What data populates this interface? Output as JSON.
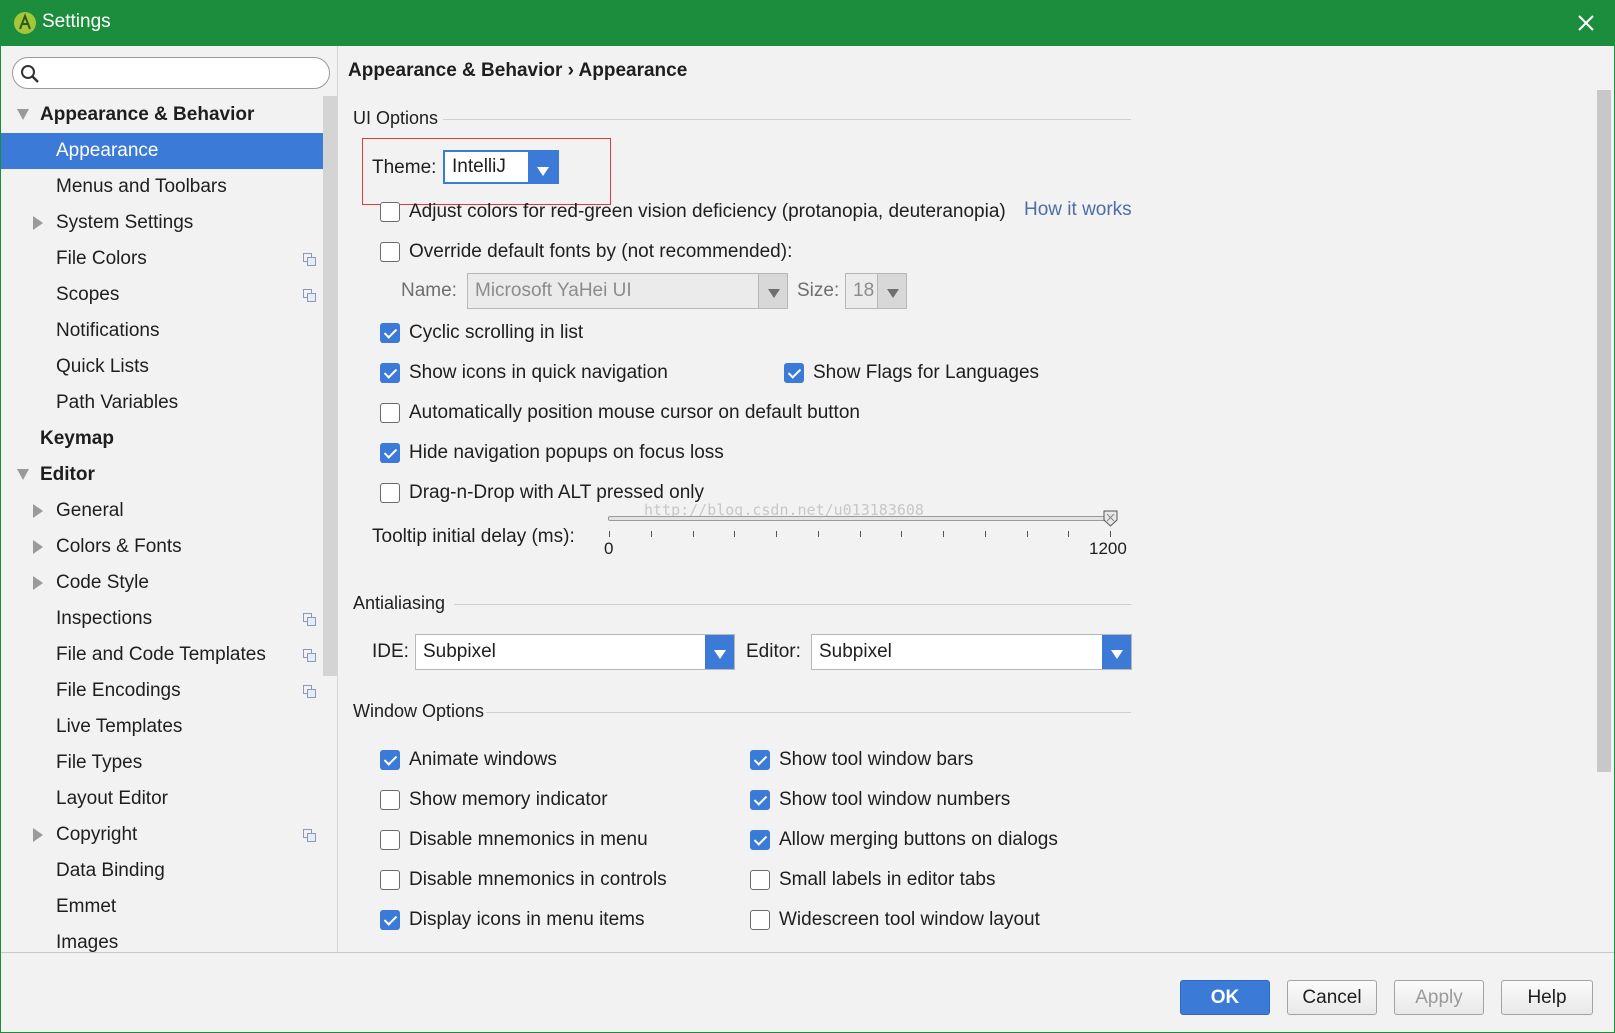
{
  "window": {
    "title": "Settings"
  },
  "search": {
    "placeholder": "",
    "value": ""
  },
  "tree": [
    {
      "label": "Appearance & Behavior",
      "level": 0,
      "arrow": "down",
      "bold": true
    },
    {
      "label": "Appearance",
      "level": 1,
      "selected": true
    },
    {
      "label": "Menus and Toolbars",
      "level": 1
    },
    {
      "label": "System Settings",
      "level": 1,
      "arrow": "right"
    },
    {
      "label": "File Colors",
      "level": 1,
      "project_icon": true
    },
    {
      "label": "Scopes",
      "level": 1,
      "project_icon": true
    },
    {
      "label": "Notifications",
      "level": 1
    },
    {
      "label": "Quick Lists",
      "level": 1
    },
    {
      "label": "Path Variables",
      "level": 1
    },
    {
      "label": "Keymap",
      "level": 0,
      "bold": true
    },
    {
      "label": "Editor",
      "level": 0,
      "arrow": "down",
      "bold": true
    },
    {
      "label": "General",
      "level": 1,
      "arrow": "right"
    },
    {
      "label": "Colors & Fonts",
      "level": 1,
      "arrow": "right"
    },
    {
      "label": "Code Style",
      "level": 1,
      "arrow": "right"
    },
    {
      "label": "Inspections",
      "level": 1,
      "project_icon": true
    },
    {
      "label": "File and Code Templates",
      "level": 1,
      "project_icon": true
    },
    {
      "label": "File Encodings",
      "level": 1,
      "project_icon": true
    },
    {
      "label": "Live Templates",
      "level": 1
    },
    {
      "label": "File Types",
      "level": 1
    },
    {
      "label": "Layout Editor",
      "level": 1
    },
    {
      "label": "Copyright",
      "level": 1,
      "arrow": "right",
      "project_icon": true
    },
    {
      "label": "Data Binding",
      "level": 1
    },
    {
      "label": "Emmet",
      "level": 1
    },
    {
      "label": "Images",
      "level": 1
    }
  ],
  "breadcrumb": "Appearance & Behavior › Appearance",
  "ui_options": {
    "title": "UI Options",
    "theme_label": "Theme:",
    "theme_value": "IntelliJ",
    "adjust_colors": {
      "label": "Adjust colors for red-green vision deficiency (protanopia, deuteranopia)",
      "checked": false
    },
    "how_it_works": "How it works",
    "override_fonts": {
      "label": "Override default fonts by (not recommended):",
      "checked": false
    },
    "font_name_label": "Name:",
    "font_name_value": "Microsoft YaHei UI",
    "font_size_label": "Size:",
    "font_size_value": "18",
    "cyclic_scrolling": {
      "label": "Cyclic scrolling in list",
      "checked": true
    },
    "show_icons_quick_nav": {
      "label": "Show icons in quick navigation",
      "checked": true
    },
    "show_flags": {
      "label": "Show Flags for Languages",
      "checked": true
    },
    "auto_mouse": {
      "label": "Automatically position mouse cursor on default button",
      "checked": false
    },
    "hide_nav_popups": {
      "label": "Hide navigation popups on focus loss",
      "checked": true
    },
    "drag_n_drop": {
      "label": "Drag-n-Drop with ALT pressed only",
      "checked": false
    },
    "tooltip_label": "Tooltip initial delay (ms):",
    "tooltip_min": "0",
    "tooltip_max": "1200",
    "tooltip_value_fraction": 1.0
  },
  "watermark": "http://blog.csdn.net/u013183608",
  "antialiasing": {
    "title": "Antialiasing",
    "ide_label": "IDE:",
    "ide_value": "Subpixel",
    "editor_label": "Editor:",
    "editor_value": "Subpixel"
  },
  "window_options": {
    "title": "Window Options",
    "animate_windows": {
      "label": "Animate windows",
      "checked": true
    },
    "show_tool_window_bars": {
      "label": "Show tool window bars",
      "checked": true
    },
    "show_memory": {
      "label": "Show memory indicator",
      "checked": false
    },
    "show_tool_window_numbers": {
      "label": "Show tool window numbers",
      "checked": true
    },
    "disable_mnemonics_menu": {
      "label": "Disable mnemonics in menu",
      "checked": false
    },
    "allow_merging": {
      "label": "Allow merging buttons on dialogs",
      "checked": true
    },
    "disable_mnemonics_controls": {
      "label": "Disable mnemonics in controls",
      "checked": false
    },
    "small_labels": {
      "label": "Small labels in editor tabs",
      "checked": false
    },
    "display_icons_menu": {
      "label": "Display icons in menu items",
      "checked": true
    },
    "widescreen_layout": {
      "label": "Widescreen tool window layout",
      "checked": false
    }
  },
  "buttons": {
    "ok": "OK",
    "cancel": "Cancel",
    "apply": "Apply",
    "help": "Help"
  },
  "colors": {
    "title_bar": "#1c8d3c",
    "accent": "#3b7ad7",
    "link": "#4a6fa5",
    "highlight_box": "#e03a3a"
  }
}
